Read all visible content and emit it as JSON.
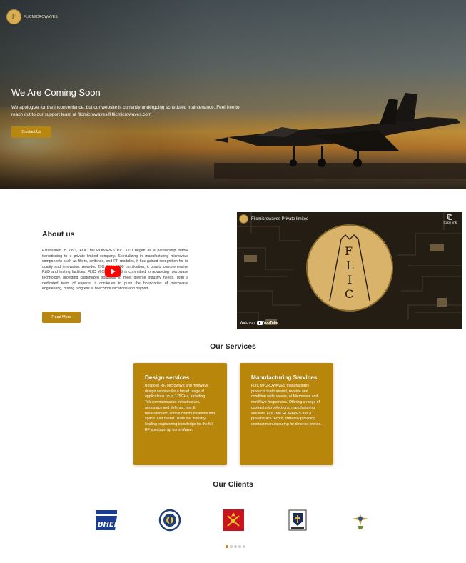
{
  "brand": {
    "name": "FLICMICROWAVES",
    "logo_text": "F"
  },
  "hero": {
    "title": "We Are Coming Soon",
    "text": "We apologize for the inconvenience, but our website is currently undergoing scheduled maintenance. Feel free to reach out to our support team at flicmicrowaves@flicmicrowaves.com",
    "button_label": "Contact Us"
  },
  "about": {
    "title": "About us",
    "text": "Established in 1993, FLIC MICROWAVES PVT LTD began as a partnership before transitioning to a private limited company. Specializing in manufacturing microwave components such as filters, switches, and RF modules, it has gained recognition for its quality and innovation. Awarded ISO 9001:2000 certification, it boasts comprehensive R&D and testing facilities. FLIC MICROWAVES is committed to advancing microwave technology, providing customized solutions to meet diverse industry needs. With a dedicated team of experts, it continues to push the boundaries of microwave engineering, driving progress in telecommunications and beyond.",
    "button_label": "Read More"
  },
  "video": {
    "channel_title": "Flicmicrowaves Private limited",
    "copy_label": "Copy link",
    "watch_on": "Watch on",
    "platform": "YouTube",
    "logo_letters": [
      "F",
      "L",
      "I",
      "C"
    ]
  },
  "services": {
    "title": "Our Services",
    "items": [
      {
        "title": "Design services",
        "text": "Bespoke RF, Microwave and mmWave design services for a broad range of applications up to 175GHz, including Telecommunication infrastructure, aerospace and defence, test & measurement, critical communications and space. Our clients utilise our industry-leading engineering knowledge for the full RF spectrum up to mmWave."
      },
      {
        "title": "Manufacturing Services",
        "text": "FLIC MICROWAVES manufactures products that transmit, receive and condition radio waves, at Microwave and mmWave frequencies. Offering a range of contract microelectronic manufacturing services, FLIC MICROWAVES has a proven track record, currently providing contract manufacturing for defence primes."
      }
    ]
  },
  "clients": {
    "title": "Our Clients",
    "logos": [
      {
        "name": "BHEL",
        "icon": "bhel-logo"
      },
      {
        "name": "DRDO",
        "icon": "drdo-logo"
      },
      {
        "name": "Indian Army",
        "icon": "army-logo"
      },
      {
        "name": "Indian Navy",
        "icon": "navy-logo"
      },
      {
        "name": "Indian Air Force",
        "icon": "airforce-logo"
      }
    ],
    "pagination_count": 5,
    "active_index": 0
  },
  "colors": {
    "accent": "#b8860b",
    "button": "#b8870f",
    "dot_active": "#c8891e"
  }
}
